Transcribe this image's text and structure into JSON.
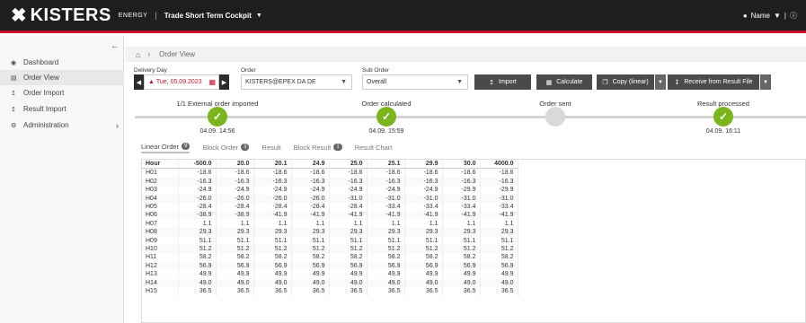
{
  "header": {
    "brand": "KISTERS",
    "brand_sub": "ENERGY",
    "app_title": "Trade Short Term Cockpit",
    "user_name": "Name"
  },
  "sidebar": {
    "items": [
      {
        "label": "Dashboard",
        "icon": "dashboard-icon"
      },
      {
        "label": "Order View",
        "icon": "cart-icon"
      },
      {
        "label": "Order Import",
        "icon": "upload-icon"
      },
      {
        "label": "Result Import",
        "icon": "upload-icon"
      },
      {
        "label": "Administration",
        "icon": "gears-icon"
      }
    ]
  },
  "breadcrumb": {
    "current": "Order View"
  },
  "form": {
    "delivery_label": "Delivery Day",
    "delivery_value": "Tue, 05.09.2023",
    "order_label": "Order",
    "order_value": "KISTERS@EPEX DA DE",
    "suborder_label": "Sub Order",
    "suborder_value": "Overall"
  },
  "toolbar": {
    "import_label": "Import",
    "calculate_label": "Calculate",
    "copy_label": "Copy (linear)",
    "receive_label": "Receive from Result File"
  },
  "steps": [
    {
      "label": "1/1 External order imported",
      "time": "04.09. 14:56",
      "done": true
    },
    {
      "label": "Order calculated",
      "time": "04.09. 15:59",
      "done": true
    },
    {
      "label": "Order sent",
      "time": "",
      "done": false
    },
    {
      "label": "Result processed",
      "time": "04.09. 16:11",
      "done": true
    }
  ],
  "tabs": [
    {
      "label": "Linear Order",
      "badge": "9"
    },
    {
      "label": "Block Order",
      "badge": "3"
    },
    {
      "label": "Result",
      "badge": ""
    },
    {
      "label": "Block Result",
      "badge": "1"
    },
    {
      "label": "Result Chart",
      "badge": ""
    }
  ],
  "table": {
    "headers": [
      "Hour",
      "-500.0",
      "20.0",
      "20.1",
      "24.9",
      "25.0",
      "25.1",
      "29.9",
      "30.0",
      "4000.0"
    ],
    "rows": [
      [
        "H01",
        "-18.6",
        "-18.6",
        "-18.6",
        "-18.6",
        "-18.6",
        "-18.6",
        "-18.6",
        "-18.6",
        "-18.6"
      ],
      [
        "H02",
        "-16.3",
        "-16.3",
        "-16.3",
        "-16.3",
        "-16.3",
        "-16.3",
        "-16.3",
        "-16.3",
        "-16.3"
      ],
      [
        "H03",
        "-24.9",
        "-24.9",
        "-24.9",
        "-24.9",
        "-24.9",
        "-24.9",
        "-24.9",
        "-29.9",
        "-29.9"
      ],
      [
        "H04",
        "-26.0",
        "-26.0",
        "-26.0",
        "-26.0",
        "-31.0",
        "-31.0",
        "-31.0",
        "-31.0",
        "-31.0"
      ],
      [
        "H05",
        "-28.4",
        "-28.4",
        "-28.4",
        "-28.4",
        "-28.4",
        "-33.4",
        "-33.4",
        "-33.4",
        "-33.4"
      ],
      [
        "H06",
        "-38.9",
        "-38.9",
        "-41.9",
        "-41.9",
        "-41.9",
        "-41.9",
        "-41.9",
        "-41.9",
        "-41.9"
      ],
      [
        "H07",
        "1.1",
        "1.1",
        "1.1",
        "1.1",
        "1.1",
        "1.1",
        "1.1",
        "1.1",
        "1.1"
      ],
      [
        "H08",
        "29.3",
        "29.3",
        "29.3",
        "29.3",
        "29.3",
        "29.3",
        "29.3",
        "29.3",
        "29.3"
      ],
      [
        "H09",
        "51.1",
        "51.1",
        "51.1",
        "51.1",
        "51.1",
        "51.1",
        "51.1",
        "51.1",
        "51.1"
      ],
      [
        "H10",
        "51.2",
        "51.2",
        "51.2",
        "51.2",
        "51.2",
        "51.2",
        "51.2",
        "51.2",
        "51.2"
      ],
      [
        "H11",
        "58.2",
        "58.2",
        "58.2",
        "58.2",
        "58.2",
        "58.2",
        "58.2",
        "58.2",
        "58.2"
      ],
      [
        "H12",
        "56.9",
        "56.9",
        "56.9",
        "56.9",
        "56.9",
        "56.9",
        "56.9",
        "56.9",
        "56.9"
      ],
      [
        "H13",
        "49.9",
        "49.9",
        "49.9",
        "49.9",
        "49.9",
        "49.9",
        "49.9",
        "49.9",
        "49.9"
      ],
      [
        "H14",
        "49.0",
        "49.0",
        "49.0",
        "49.0",
        "49.0",
        "49.0",
        "49.0",
        "49.0",
        "49.0"
      ],
      [
        "H15",
        "36.5",
        "36.5",
        "36.5",
        "36.5",
        "36.5",
        "36.5",
        "36.5",
        "36.5",
        "36.5"
      ]
    ]
  },
  "colors": {
    "accent": "#c8102e",
    "done": "#7ab51d",
    "pending": "#d9d9d9",
    "topbar": "#1e1e1e"
  }
}
